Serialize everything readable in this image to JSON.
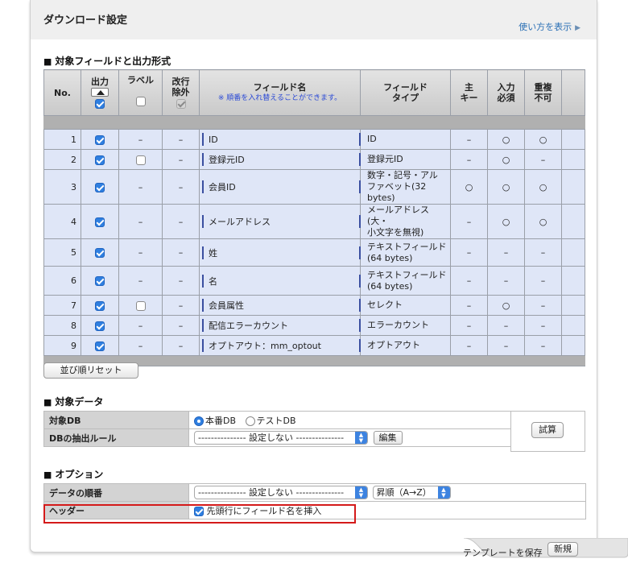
{
  "header": {
    "title": "ダウンロード設定",
    "help_link": "使い方を表示"
  },
  "fields_section": {
    "title": "対象フィールドと出力形式",
    "columns": {
      "no": "No.",
      "output": "出力",
      "label": "ラベル",
      "exclude_newline_1": "改行",
      "exclude_newline_2": "除外",
      "field_name": "フィールド名",
      "field_name_note": "※ 順番を入れ替えることができます。",
      "field_type_1": "フィールド",
      "field_type_2": "タイプ",
      "primary_key_1": "主",
      "primary_key_2": "キー",
      "required_1": "入力",
      "required_2": "必須",
      "unique_1": "重複",
      "unique_2": "不可"
    },
    "rows": [
      {
        "no": "1",
        "output": true,
        "label": "–",
        "exclude": "–",
        "name": "ID",
        "type": "ID",
        "type_sub": "",
        "pk": "–",
        "required": "○",
        "unique": "○"
      },
      {
        "no": "2",
        "output": true,
        "label": "box",
        "exclude": "–",
        "name": "登録元ID",
        "type": "登録元ID",
        "type_sub": "",
        "pk": "–",
        "required": "○",
        "unique": "–"
      },
      {
        "no": "3",
        "output": true,
        "label": "–",
        "exclude": "–",
        "name": "会員ID",
        "type": "数字・記号・アル",
        "type_sub": "ファベット(32 bytes)",
        "pk": "○",
        "required": "○",
        "unique": "○"
      },
      {
        "no": "4",
        "output": true,
        "label": "–",
        "exclude": "–",
        "name": "メールアドレス",
        "type": "メールアドレス(大・",
        "type_sub": "小文字を無視)",
        "pk": "–",
        "required": "○",
        "unique": "○"
      },
      {
        "no": "5",
        "output": true,
        "label": "–",
        "exclude": "–",
        "name": "姓",
        "type": "テキストフィールド",
        "type_sub": "(64 bytes)",
        "pk": "–",
        "required": "–",
        "unique": "–"
      },
      {
        "no": "6",
        "output": true,
        "label": "–",
        "exclude": "–",
        "name": "名",
        "type": "テキストフィールド",
        "type_sub": "(64 bytes)",
        "pk": "–",
        "required": "–",
        "unique": "–"
      },
      {
        "no": "7",
        "output": true,
        "label": "box",
        "exclude": "–",
        "name": "会員属性",
        "type": "セレクト",
        "type_sub": "",
        "pk": "–",
        "required": "○",
        "unique": "–"
      },
      {
        "no": "8",
        "output": true,
        "label": "–",
        "exclude": "–",
        "name": "配信エラーカウント",
        "type": "エラーカウント",
        "type_sub": "",
        "pk": "–",
        "required": "–",
        "unique": "–"
      },
      {
        "no": "9",
        "output": true,
        "label": "–",
        "exclude": "–",
        "name": "オプトアウト：mm_optout",
        "type": "オプトアウト",
        "type_sub": "",
        "pk": "–",
        "required": "–",
        "unique": "–"
      }
    ],
    "reset_button": "並び順リセット"
  },
  "target_section": {
    "title": "対象データ",
    "db_label": "対象DB",
    "db_options": [
      "本番DB",
      "テストDB"
    ],
    "rule_label": "DBの抽出ルール",
    "rule_value": "--------------- 設定しない ---------------",
    "edit_button": "編集",
    "test_button": "試算"
  },
  "option_section": {
    "title": "オプション",
    "order_label": "データの順番",
    "order_value": "--------------- 設定しない ---------------",
    "order_dir": "昇順（A→Z）",
    "header_label": "ヘッダー",
    "header_checkbox": "先頭行にフィールド名を挿入"
  },
  "footer": {
    "save_template": "テンプレートを保存",
    "new_button": "新規"
  },
  "colors": {
    "accent": "#2f7fe0",
    "row_bg": "#dfe6f7",
    "highlight": "#d41a1a",
    "link": "#2a6fb5"
  }
}
